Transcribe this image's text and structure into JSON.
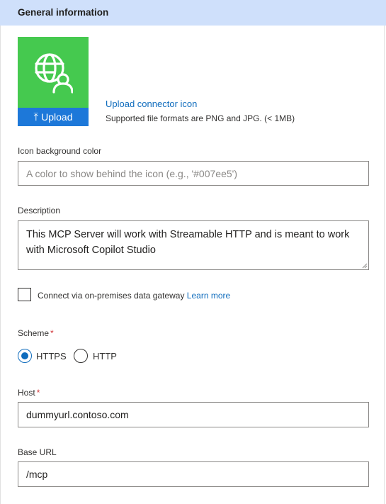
{
  "section": {
    "title": "General information"
  },
  "icon_area": {
    "tile_icon": "globe-user-icon",
    "tile_color": "#45c94f",
    "upload_button_label": "Upload",
    "upload_button_color": "#1d78d9",
    "upload_link": "Upload connector icon",
    "upload_hint": "Supported file formats are PNG and JPG. (< 1MB)"
  },
  "icon_background": {
    "label": "Icon background color",
    "value": "",
    "placeholder": "A color to show behind the icon (e.g., '#007ee5')"
  },
  "description": {
    "label": "Description",
    "value": "This MCP Server will work with Streamable HTTP and is meant to work with Microsoft Copilot Studio"
  },
  "gateway": {
    "checked": false,
    "label": "Connect via on-premises data gateway",
    "learn_more": "Learn more"
  },
  "scheme": {
    "label": "Scheme",
    "required_mark": "*",
    "options": [
      {
        "label": "HTTPS",
        "selected": true
      },
      {
        "label": "HTTP",
        "selected": false
      }
    ]
  },
  "host": {
    "label": "Host",
    "required_mark": "*",
    "value": "dummyurl.contoso.com"
  },
  "base_url": {
    "label": "Base URL",
    "value": "/mcp"
  },
  "colors": {
    "header_background": "#cfe0fb",
    "accent": "#0f6cbd",
    "required": "#d13438"
  }
}
